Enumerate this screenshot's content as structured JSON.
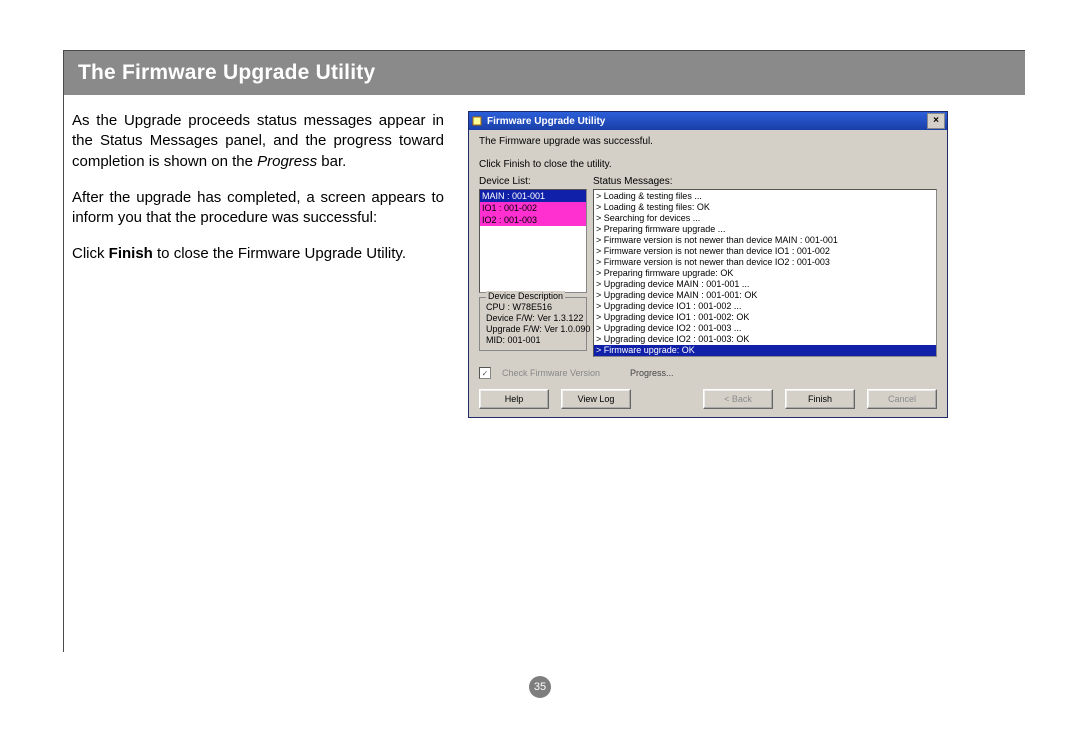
{
  "doc": {
    "section_title": "The Firmware Upgrade Utility",
    "para1_a": "As the Upgrade proceeds status messages appear in the Status Messages panel, and the progress toward completion is shown on the ",
    "para1_italic": "Progress",
    "para1_b": " bar.",
    "para2": "After the upgrade has completed, a screen appears to inform you that the procedure was successful:",
    "para3_a": "Click ",
    "para3_bold": "Finish",
    "para3_b": " to close the Firmware Upgrade Utility.",
    "page_number": "35"
  },
  "win": {
    "title": "Firmware Upgrade Utility",
    "close": "×",
    "msg": "The Firmware upgrade was successful.",
    "sub": "Click Finish to close the utility.",
    "device_list_label": "Device List:",
    "status_label": "Status Messages:",
    "device_list": [
      "MAIN : 001-001",
      "IO1 : 001-002",
      "IO2 : 001-003"
    ],
    "status_messages": [
      "> Loading & testing files ...",
      "> Loading & testing files: OK",
      "> Searching for devices ...",
      "> Preparing firmware upgrade ...",
      "> Firmware version is not newer than device MAIN : 001-001",
      "> Firmware version is not newer than device IO1 : 001-002",
      "> Firmware version is not newer than device IO2 : 001-003",
      "> Preparing firmware upgrade: OK",
      "> Upgrading device MAIN : 001-001 ...",
      "> Upgrading device MAIN : 001-001: OK",
      "> Upgrading device IO1 : 001-002 ...",
      "> Upgrading device IO1 : 001-002: OK",
      "> Upgrading device IO2 : 001-003 ...",
      "> Upgrading device IO2 : 001-003: OK",
      "> Firmware upgrade: OK"
    ],
    "desc_legend": "Device Description",
    "desc_lines": [
      "CPU : W78E516",
      "Device F/W: Ver 1.3.122",
      "Upgrade F/W: Ver 1.0.090",
      "MID: 001-001"
    ],
    "check_label": "Check Firmware Version",
    "progress_label": "Progress...",
    "buttons": {
      "help": "Help",
      "viewlog": "View Log",
      "back": "< Back",
      "finish": "Finish",
      "cancel": "Cancel"
    }
  }
}
